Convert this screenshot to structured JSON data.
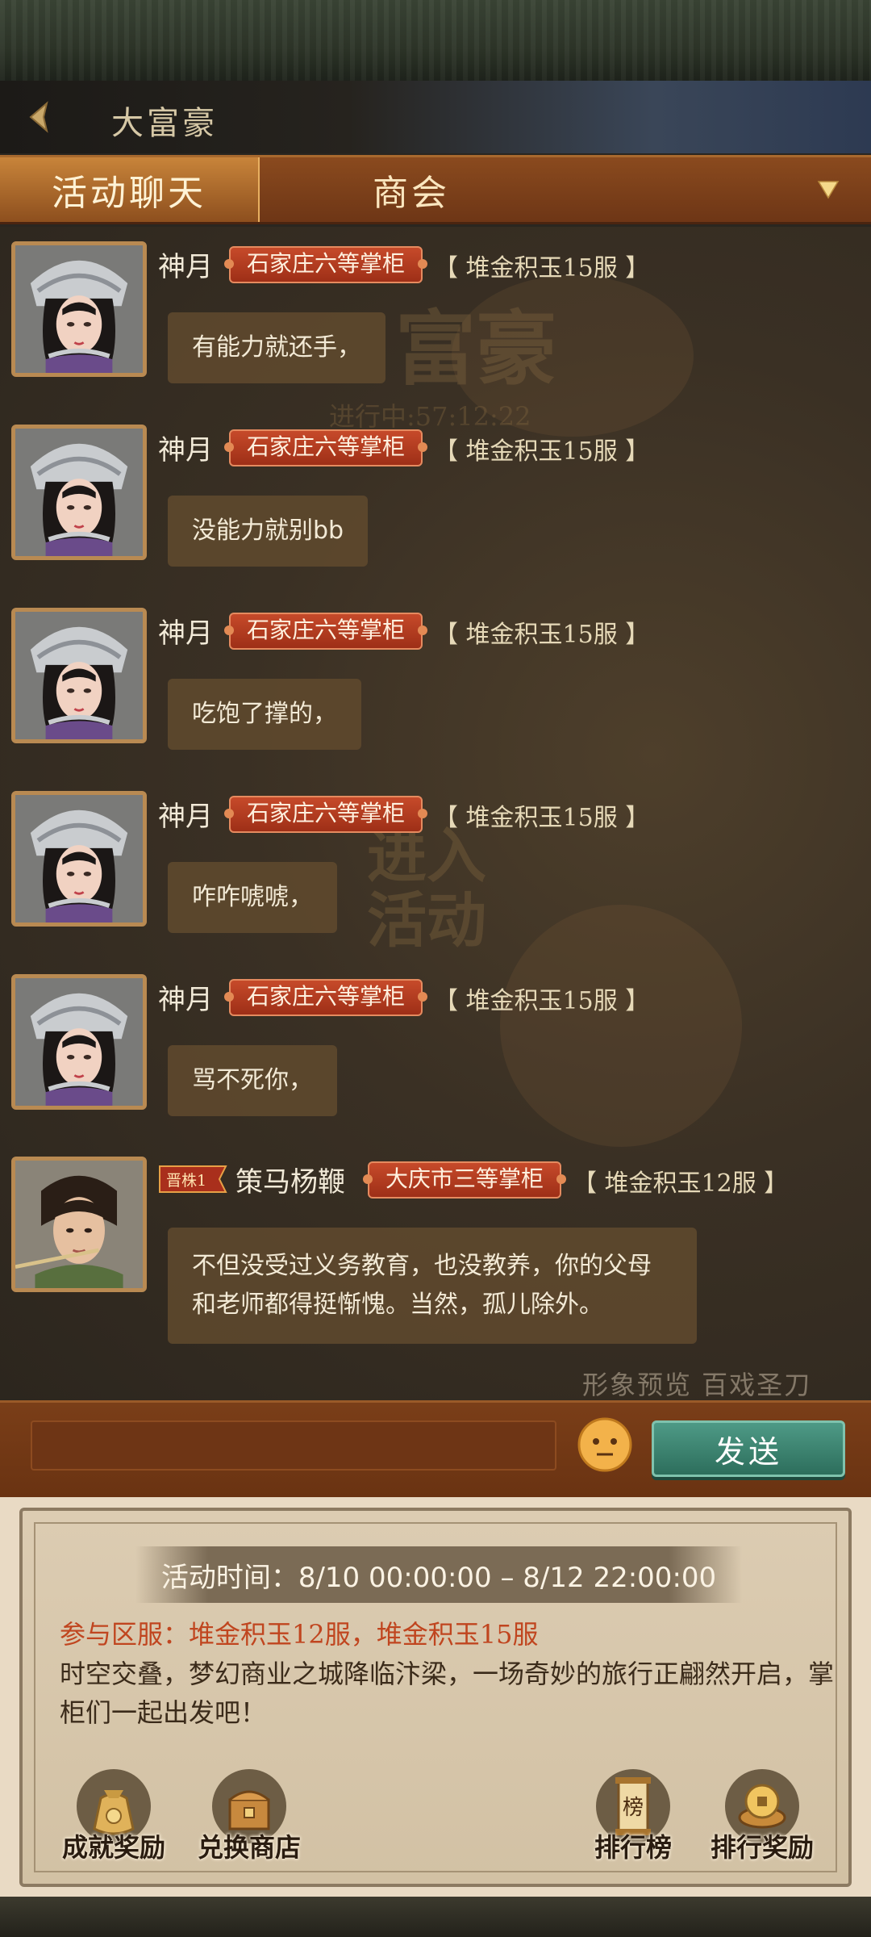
{
  "header": {
    "title": "大富豪"
  },
  "tabs": {
    "active": "活动聊天",
    "other": "商会"
  },
  "messages": [
    {
      "name": "神月",
      "rank": "石家庄六等掌柜",
      "server": "【 堆金积玉15服 】",
      "text": "有能力就还手，"
    },
    {
      "name": "神月",
      "rank": "石家庄六等掌柜",
      "server": "【 堆金积玉15服 】",
      "text": "没能力就别bb"
    },
    {
      "name": "神月",
      "rank": "石家庄六等掌柜",
      "server": "【 堆金积玉15服 】",
      "text": "吃饱了撑的，"
    },
    {
      "name": "神月",
      "rank": "石家庄六等掌柜",
      "server": "【 堆金积玉15服 】",
      "text": "咋咋唬唬，"
    },
    {
      "name": "神月",
      "rank": "石家庄六等掌柜",
      "server": "【 堆金积玉15服 】",
      "text": "骂不死你，"
    },
    {
      "badge": "晋株1",
      "name": "策马杨鞭",
      "rank": "大庆市三等掌柜",
      "server": "【 堆金积玉12服 】",
      "text": "不但没受过义务教育，也没教养，你的父母和老师都得挺惭愧。当然，孤儿除外。"
    }
  ],
  "background_text": {
    "big_title": "富豪",
    "countdown": "进行中:57:12:22",
    "enter": "进入",
    "activity": "活动",
    "preview": "形象预览  百戏圣刀"
  },
  "input": {
    "value": "",
    "placeholder": "",
    "send_label": "发送"
  },
  "panel": {
    "time": "活动时间：8/10 00:00:00 – 8/12 22:00:00",
    "servers": "参与区服：堆金积玉12服，堆金积玉15服",
    "desc": "时空交叠，梦幻商业之城降临汴梁，一场奇妙的旅行正翩然开启，掌柜们一起出发吧！",
    "buttons": [
      {
        "label": "成就奖励",
        "icon": "money-bag-icon"
      },
      {
        "label": "兑换商店",
        "icon": "shop-chest-icon"
      },
      {
        "label": "排行榜",
        "icon": "ranking-scroll-icon",
        "glyph": "榜"
      },
      {
        "label": "排行奖励",
        "icon": "coin-reward-icon"
      }
    ]
  },
  "colors": {
    "tab_bar": "#7a3e18",
    "rank_tag": "#b23d20",
    "send_button": "#3d8470",
    "server_text": "#c0451f"
  }
}
